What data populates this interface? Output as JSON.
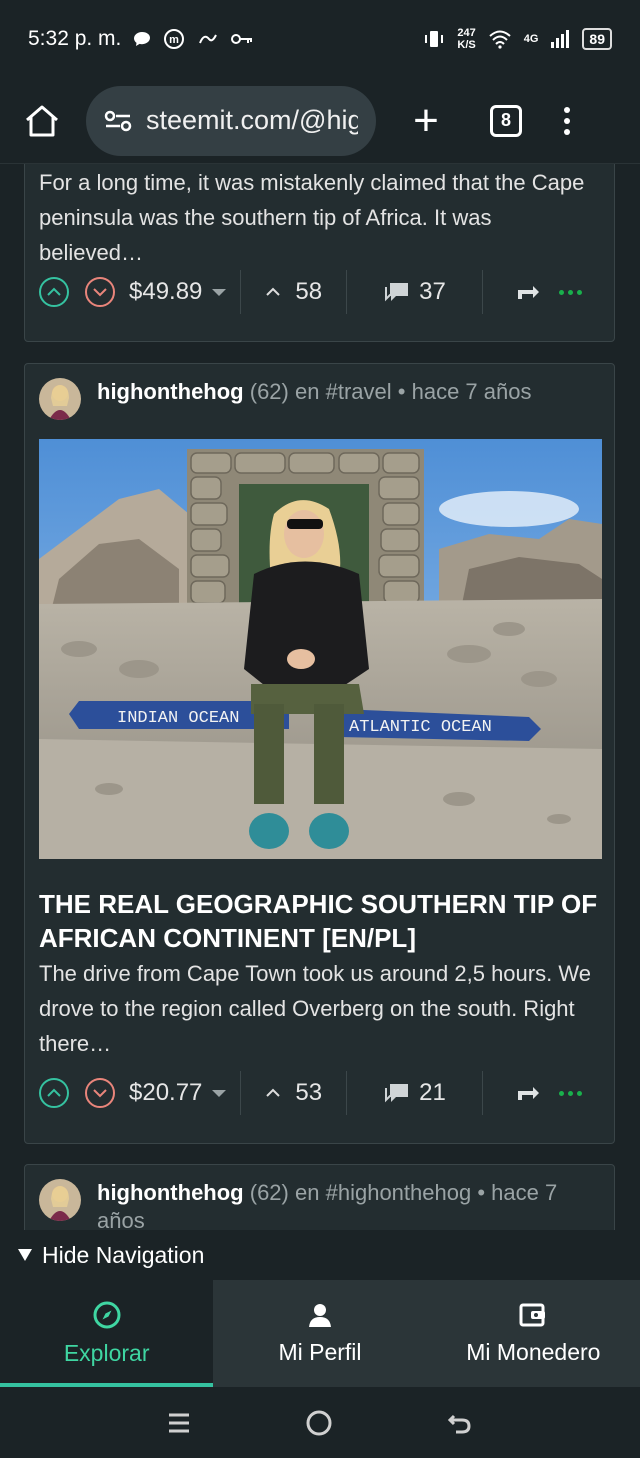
{
  "status": {
    "time": "5:32 p. m.",
    "net_speed": "247\nK/S",
    "net_speed_top": "247",
    "net_speed_bottom": "K/S",
    "network": "4G",
    "battery": "89"
  },
  "browser": {
    "url": "steemit.com/@highonthehog",
    "tab_count": "8"
  },
  "posts": [
    {
      "excerpt": "For a long time, it was mistakenly claimed that the Cape peninsula was the southern tip of Africa. It was believed…",
      "payout": "$49.89",
      "votes": "58",
      "comments": "37"
    },
    {
      "author": "highonthehog",
      "reputation": "(62)",
      "in_label": "en",
      "category": "#travel",
      "bullet": "•",
      "time": "hace 7 años",
      "image_sign_left": "INDIAN OCEAN",
      "image_sign_right": "ATLANTIC OCEAN",
      "title": "THE REAL GEOGRAPHIC SOUTHERN TIP OF AFRICAN CONTINENT [EN/PL]",
      "excerpt": "The drive from Cape Town took us around 2,5 hours. We drove to the region called Overberg on the south. Right there…",
      "payout": "$20.77",
      "votes": "53",
      "comments": "21"
    },
    {
      "author": "highonthehog",
      "reputation": "(62)",
      "in_label": "en",
      "category": "#highonthehog",
      "bullet": "•",
      "time": "hace 7 años"
    }
  ],
  "nav": {
    "hide_label": "Hide Navigation",
    "items": [
      {
        "label": "Explorar",
        "icon": "compass-icon"
      },
      {
        "label": "Mi Perfil",
        "icon": "user-icon"
      },
      {
        "label": "Mi Monedero",
        "icon": "wallet-icon"
      }
    ]
  },
  "colors": {
    "accent": "#35c2a0",
    "downvote": "#e9857b",
    "background": "#1b2326",
    "card": "#232d30"
  }
}
